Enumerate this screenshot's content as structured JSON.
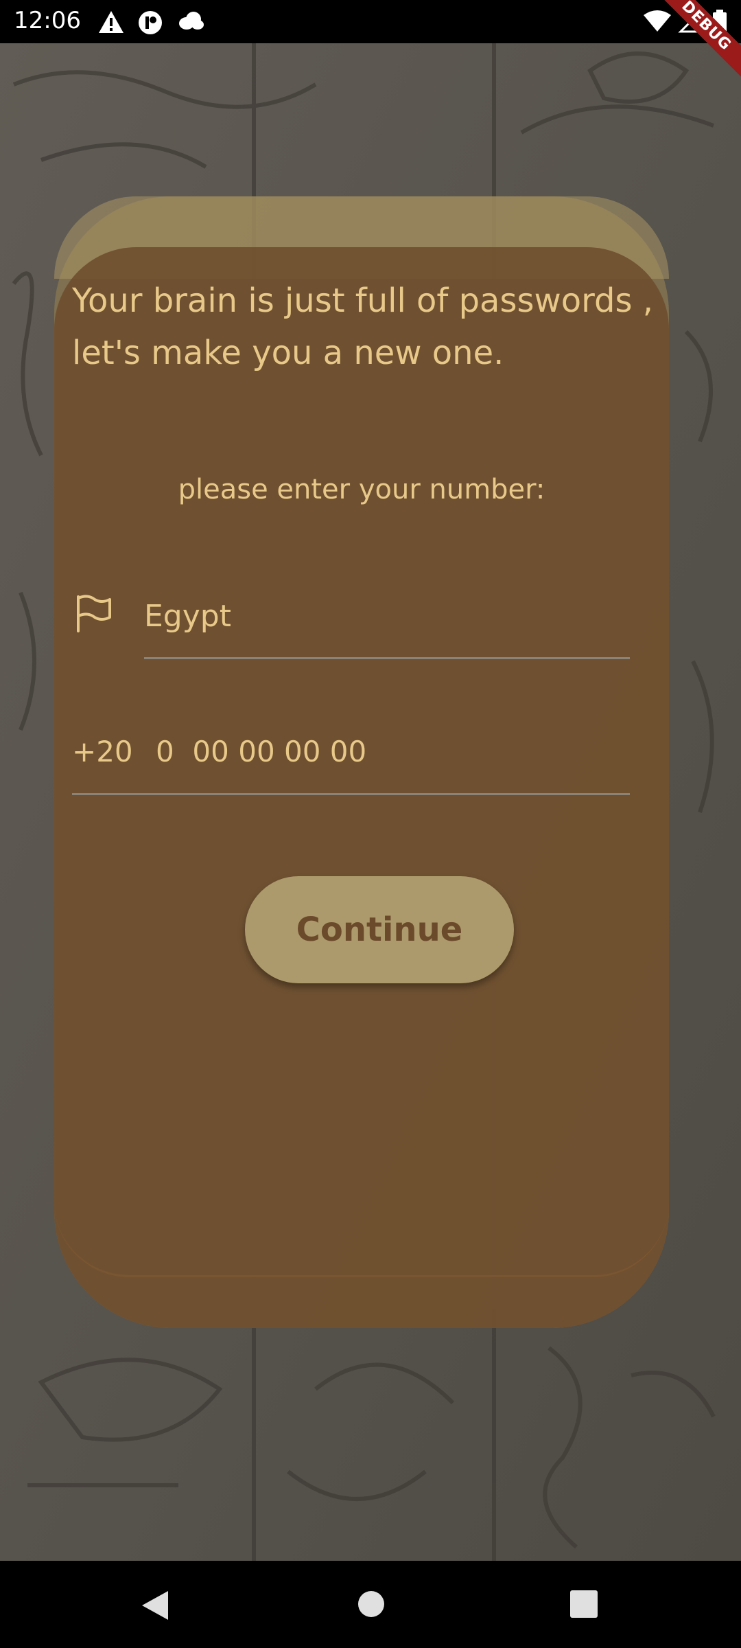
{
  "status_bar": {
    "time": "12:06",
    "icons": [
      "warning-icon",
      "ppl-icon",
      "cloud-icon",
      "wifi-icon",
      "signal-icon",
      "battery-icon"
    ],
    "debug_label": "DEBUG"
  },
  "card": {
    "headline": "Your brain is just full of passwords , let's make you a new one.",
    "prompt": "please enter your number:",
    "country_label": "Egypt",
    "country_icon": "flag-icon",
    "dial_code": "+20",
    "phone_placeholder": "0  00 00 00 00",
    "continue_label": "Continue"
  },
  "nav_bar": {
    "icons": [
      "back-icon",
      "home-icon",
      "recent-apps-icon"
    ]
  },
  "colors": {
    "text_accent": "#e8c98a",
    "card_brown": "#6e4e2e",
    "button_fill": "#ad9a6c",
    "button_text": "#6b4a2b"
  }
}
